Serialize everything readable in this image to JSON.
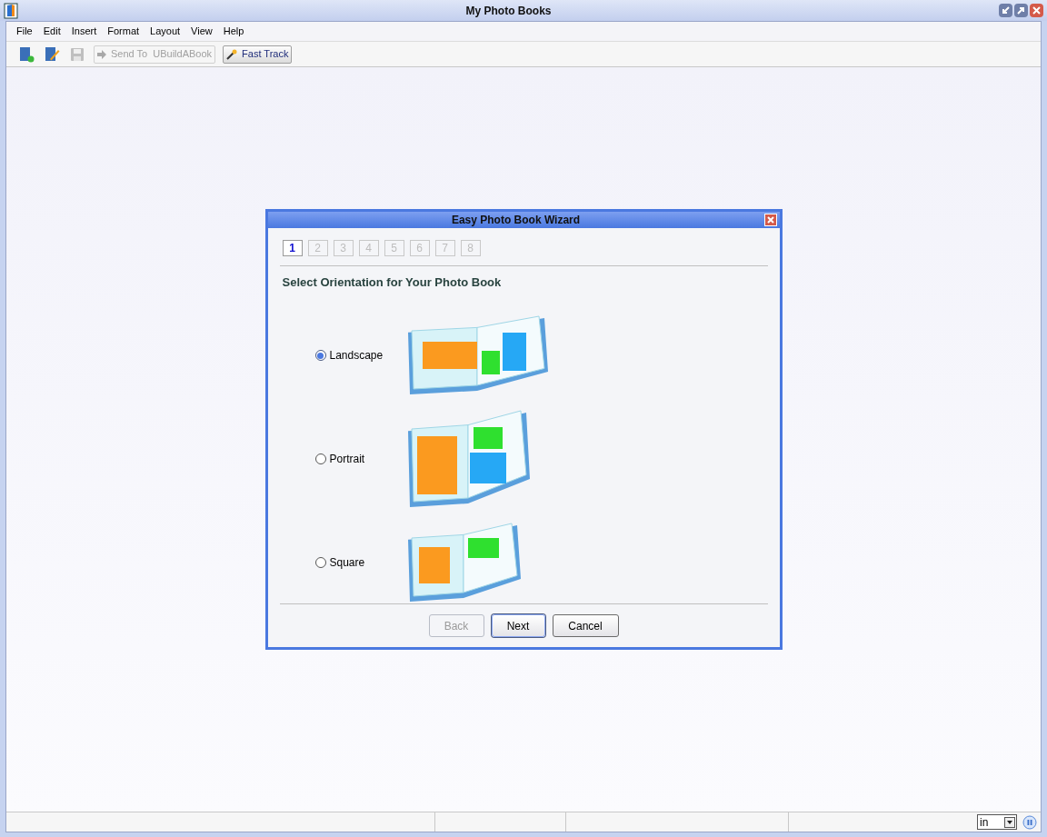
{
  "window": {
    "title": "My Photo Books"
  },
  "menu": [
    "File",
    "Edit",
    "Insert",
    "Format",
    "Layout",
    "View",
    "Help"
  ],
  "toolbar": [
    {
      "kind": "new"
    },
    {
      "kind": "edit"
    },
    {
      "kind": "save",
      "disabled": true
    },
    {
      "kind": "send",
      "label": "Send To  UBuildABook",
      "disabled": true
    },
    {
      "kind": "fasttrack",
      "label": "Fast Track",
      "disabled": false
    }
  ],
  "dialog": {
    "title": "Easy Photo Book Wizard",
    "steps": [
      {
        "label": "1",
        "selected": true
      },
      {
        "label": "2",
        "selected": false
      },
      {
        "label": "3",
        "selected": false
      },
      {
        "label": "4",
        "selected": false
      },
      {
        "label": "5",
        "selected": false
      },
      {
        "label": "6",
        "selected": false
      },
      {
        "label": "7",
        "selected": false
      },
      {
        "label": "8",
        "selected": false
      }
    ],
    "heading": "Select Orientation for Your Photo Book",
    "options": [
      {
        "label": "Landscape",
        "kind": "landscape",
        "selected": true
      },
      {
        "label": "Portrait",
        "kind": "portrait",
        "selected": false
      },
      {
        "label": "Square",
        "kind": "square",
        "selected": false
      }
    ],
    "buttons": [
      {
        "label": "Back",
        "disabled": true,
        "default": false
      },
      {
        "label": "Next",
        "disabled": false,
        "default": true
      },
      {
        "label": "Cancel",
        "disabled": false,
        "default": false
      }
    ]
  },
  "status_bar": {
    "unit": "in"
  }
}
